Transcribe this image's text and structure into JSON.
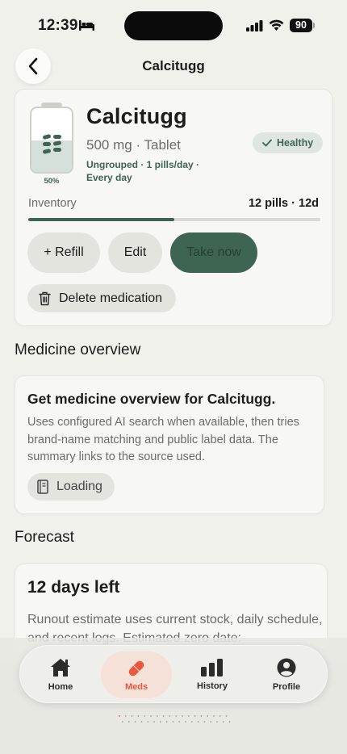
{
  "status_bar": {
    "time": "12:39",
    "battery": "90"
  },
  "nav": {
    "title": "Calcitugg"
  },
  "medication": {
    "name": "Calcitugg",
    "dose": "500 mg · Tablet",
    "meta_line1": "Ungrouped · 1 pills/day ·",
    "meta_line2": "Every day",
    "fill_percent_label": "50%",
    "fill_fraction": 0.5,
    "status": "Healthy",
    "inventory_label": "Inventory",
    "inventory_value": "12 pills · 12d",
    "inventory_fraction": 0.5
  },
  "actions": {
    "refill": "+ Refill",
    "edit": "Edit",
    "take_now": "Take now",
    "delete": "Delete medication"
  },
  "overview": {
    "section_title": "Medicine overview",
    "title": "Get medicine overview for Calcitugg.",
    "description": "Uses configured AI search when available, then tries brand-name matching and public label data. The summary links to the source used.",
    "loading": "Loading"
  },
  "forecast": {
    "section_title": "Forecast",
    "title": "12 days left",
    "description": "Runout estimate uses current stock, daily schedule, and recent logs. Estimated zero date:"
  },
  "tabs": [
    {
      "label": "Home",
      "icon": "house-icon"
    },
    {
      "label": "Meds",
      "icon": "capsule-icon",
      "active": true
    },
    {
      "label": "History",
      "icon": "bar-chart-icon"
    },
    {
      "label": "Profile",
      "icon": "person-icon"
    }
  ],
  "colors": {
    "accent": "#3e6452",
    "active_tab": "#e8573e",
    "background": "#f1f1ec"
  }
}
